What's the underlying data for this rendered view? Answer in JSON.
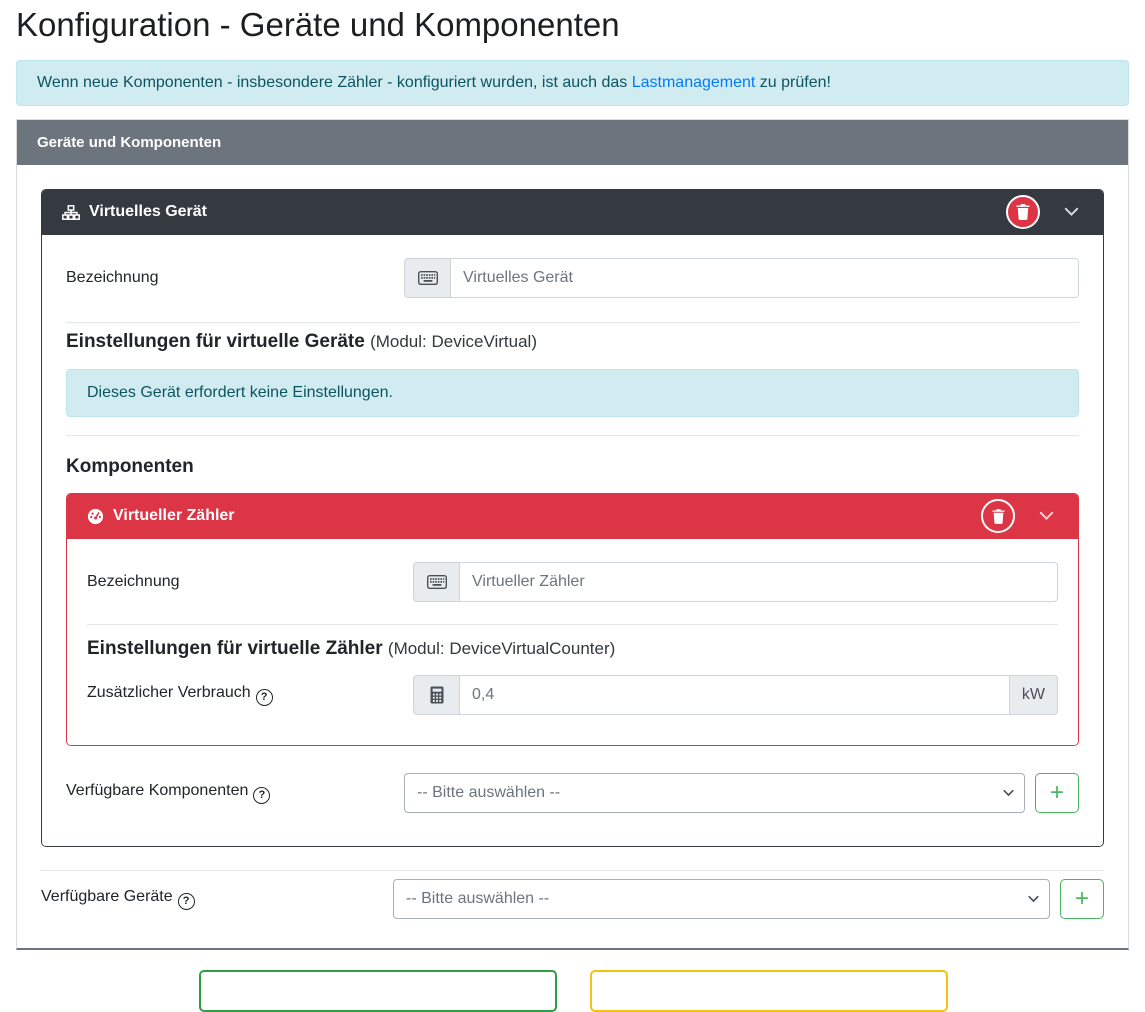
{
  "page_title": "Konfiguration - Geräte und Komponenten",
  "top_alert": {
    "text_before": "Wenn neue Komponenten - insbesondere Zähler - konfiguriert wurden, ist auch das ",
    "link_text": "Lastmanagement",
    "text_after": " zu prüfen!"
  },
  "panel": {
    "title": "Geräte und Komponenten"
  },
  "device_card": {
    "title": "Virtuelles Gerät",
    "icon": "sitemap-icon",
    "bezeichnung_label": "Bezeichnung",
    "bezeichnung_placeholder": "Virtuelles Gerät",
    "settings_heading": "Einstellungen für virtuelle Geräte",
    "settings_module": "(Modul: DeviceVirtual)",
    "no_settings_alert": "Dieses Gerät erfordert keine Einstellungen.",
    "components_heading": "Komponenten"
  },
  "component_card": {
    "title": "Virtueller Zähler",
    "icon": "tachometer-icon",
    "bezeichnung_label": "Bezeichnung",
    "bezeichnung_placeholder": "Virtueller Zähler",
    "settings_heading": "Einstellungen für virtuelle Zähler",
    "settings_module": "(Modul: DeviceVirtualCounter)",
    "verbrauch_label": "Zusätzlicher Verbrauch",
    "verbrauch_placeholder": "0,4",
    "verbrauch_unit": "kW"
  },
  "available_components": {
    "label": "Verfügbare Komponenten",
    "selected_option": "-- Bitte auswählen --",
    "add_button": "+"
  },
  "available_devices": {
    "label": "Verfügbare Geräte",
    "selected_option": "-- Bitte auswählen --",
    "add_button": "+"
  },
  "colors": {
    "danger": "#dc3545",
    "dark_header": "#343a40",
    "panel_header": "#6c757d",
    "info_bg": "#d1ecf1",
    "info_text": "#0c5460",
    "link": "#007bff",
    "add_button_green": "#4ab563",
    "bottom_button_green": "#2f9e44",
    "bottom_button_yellow": "#f5c211"
  }
}
